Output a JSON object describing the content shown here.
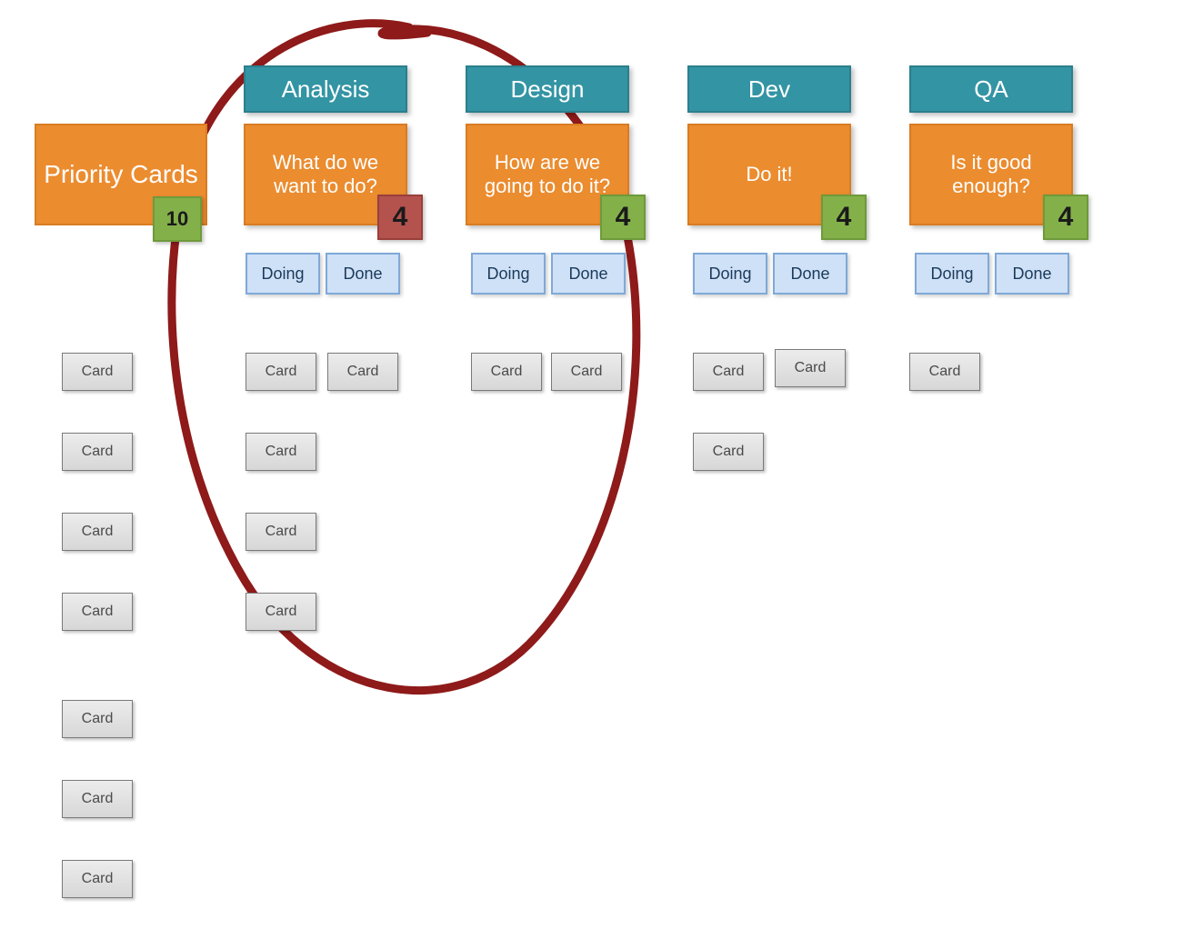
{
  "priority": {
    "title": "Priority Cards",
    "wip": 10,
    "wip_color": "green",
    "card_label": "Card",
    "card_count": 7
  },
  "stages": [
    {
      "id": "analysis",
      "title": "Analysis",
      "desc": "What do we want to do?",
      "wip": 4,
      "wip_color": "red",
      "sub_doing": "Doing",
      "sub_done": "Done",
      "doing_cards": 4,
      "done_cards": 1,
      "card_label": "Card"
    },
    {
      "id": "design",
      "title": "Design",
      "desc": "How are we going to do it?",
      "wip": 4,
      "wip_color": "green",
      "sub_doing": "Doing",
      "sub_done": "Done",
      "doing_cards": 1,
      "done_cards": 1,
      "card_label": "Card"
    },
    {
      "id": "dev",
      "title": "Dev",
      "desc": "Do it!",
      "wip": 4,
      "wip_color": "green",
      "sub_doing": "Doing",
      "sub_done": "Done",
      "doing_cards": 2,
      "done_cards": 1,
      "card_label": "Card"
    },
    {
      "id": "qa",
      "title": "QA",
      "desc": "Is it good enough?",
      "wip": 4,
      "wip_color": "green",
      "sub_doing": "Doing",
      "sub_done": "Done",
      "doing_cards": 1,
      "done_cards": 0,
      "card_label": "Card"
    }
  ],
  "annotation": {
    "color": "#8e1a1a",
    "large_circle": true,
    "inner_scribble_on_stage": "design"
  }
}
